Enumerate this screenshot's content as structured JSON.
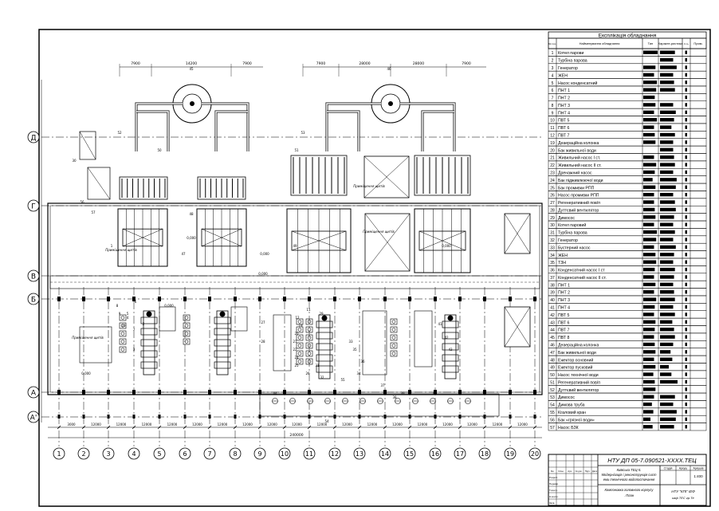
{
  "spec": {
    "title": "Експлікація обладнання",
    "col_headers": {
      "num": "№ поз.",
      "name": "Найменування обладнання",
      "type": "Тип",
      "char": "Характе-ристика",
      "qty": "К-ть",
      "note": "Прим."
    },
    "rows": [
      {
        "n": "1",
        "name": "Котел парови"
      },
      {
        "n": "2",
        "name": "Турбіна парова"
      },
      {
        "n": "3",
        "name": "Генератор"
      },
      {
        "n": "4",
        "name": "ЖЕН"
      },
      {
        "n": "5",
        "name": "Насос конденсатний"
      },
      {
        "n": "6",
        "name": "ПНТ 1"
      },
      {
        "n": "7",
        "name": "ПНТ 2"
      },
      {
        "n": "8",
        "name": "ПНТ 3"
      },
      {
        "n": "9",
        "name": "ПНТ 4"
      },
      {
        "n": "10",
        "name": "ПВТ 5"
      },
      {
        "n": "11",
        "name": "ПВТ 6"
      },
      {
        "n": "12",
        "name": "ПВТ 7"
      },
      {
        "n": "19",
        "name": "Деаераційна колонка"
      },
      {
        "n": "20",
        "name": "Бак живильної води"
      },
      {
        "n": "21",
        "name": "Живильний насос І ст."
      },
      {
        "n": "22",
        "name": "Живильний насос ІІ ст."
      },
      {
        "n": "23",
        "name": "Дренажний насос"
      },
      {
        "n": "24",
        "name": "Бак підживлюючої води"
      },
      {
        "n": "25",
        "name": "Бак промивки РПП"
      },
      {
        "n": "26",
        "name": "Насос промивки РПП"
      },
      {
        "n": "27",
        "name": "Регенеративний пов/п"
      },
      {
        "n": "28",
        "name": "Дуттєвий вентилятор"
      },
      {
        "n": "29",
        "name": "Димосос"
      },
      {
        "n": "30",
        "name": "Котел паровий"
      },
      {
        "n": "31",
        "name": "Турбіна парова"
      },
      {
        "n": "32",
        "name": "Генератор"
      },
      {
        "n": "33",
        "name": "Бустерний насос"
      },
      {
        "n": "34",
        "name": "ЖЕН"
      },
      {
        "n": "35",
        "name": "ТЗН"
      },
      {
        "n": "36",
        "name": "Конденсатний насос І ст"
      },
      {
        "n": "37",
        "name": "Конденсатний насос ІІ ст."
      },
      {
        "n": "38",
        "name": "ПНТ 1"
      },
      {
        "n": "39",
        "name": "ПНТ 2"
      },
      {
        "n": "40",
        "name": "ПНТ 3"
      },
      {
        "n": "41",
        "name": "ПНТ 4"
      },
      {
        "n": "42",
        "name": "ПВТ 5"
      },
      {
        "n": "43",
        "name": "ПВТ 6"
      },
      {
        "n": "44",
        "name": "ПВТ 7"
      },
      {
        "n": "45",
        "name": "ПВТ 8"
      },
      {
        "n": "46",
        "name": "Деаераційна колонка"
      },
      {
        "n": "47",
        "name": "Бак живильної води"
      },
      {
        "n": "48",
        "name": "Ежектор основний"
      },
      {
        "n": "49",
        "name": "Ежектор пусковий"
      },
      {
        "n": "50",
        "name": "Насос технічної води"
      },
      {
        "n": "51",
        "name": "Регенеративний пов/п"
      },
      {
        "n": "52",
        "name": "Дуттєвий вентилятор"
      },
      {
        "n": "53",
        "name": "Димосос"
      },
      {
        "n": "54",
        "name": "Димова труба"
      },
      {
        "n": "55",
        "name": "Козловий кран"
      },
      {
        "n": "56",
        "name": "Бак «грязної води»"
      },
      {
        "n": "57",
        "name": "Насос БЗК"
      }
    ]
  },
  "plan": {
    "axes_letters": [
      "Д",
      "Г",
      "В",
      "Б",
      "А",
      "А'"
    ],
    "axes_numbers": [
      "1",
      "2",
      "3",
      "4",
      "5",
      "6",
      "7",
      "8",
      "9",
      "10",
      "11",
      "12",
      "13",
      "14",
      "15",
      "16",
      "17",
      "18",
      "19",
      "20"
    ],
    "dims_top_left": [
      "7900",
      "14200",
      "7900"
    ],
    "dims_top_right": [
      "7900",
      "28000",
      "28000",
      "7900"
    ],
    "dims_bottom": [
      "3000",
      "12000",
      "12000",
      "12000",
      "12000",
      "12000",
      "12000",
      "12000",
      "12000",
      "12000",
      "12000",
      "12000",
      "12000",
      "12000",
      "12000",
      "12000",
      "12000",
      "12000",
      "12000"
    ],
    "dim_bottom_total": "240000",
    "room_labels": [
      "Приміщення щитів",
      "Приміщення щитів",
      "Приміщення щитів",
      "Приміщення щитів"
    ],
    "marks": [
      "0,000",
      "0,000",
      "0,000",
      "0,000",
      "0,000",
      "0,000"
    ],
    "callouts": [
      "56",
      "57",
      "30",
      "1",
      "2",
      "3",
      "4",
      "5",
      "6",
      "7",
      "8",
      "9",
      "10",
      "11",
      "12",
      "19",
      "20",
      "21",
      "22",
      "24",
      "25",
      "26",
      "27",
      "28",
      "29",
      "31",
      "32",
      "33",
      "34",
      "35",
      "36",
      "37",
      "38",
      "39",
      "40",
      "41",
      "42",
      "43",
      "44",
      "45",
      "46",
      "47",
      "48",
      "49",
      "50",
      "51",
      "52",
      "53",
      "54",
      "55"
    ]
  },
  "stamp": {
    "code": "НТУ ДП 05-7.090521-ХХХХ.ТЕЦ",
    "project_title": "Київська ТЕЦ-5. Модернізація і реконструкція системи технічного водопостачання",
    "sheet_title": "Компоновка головного корпусу. План",
    "stage_hdr": "Стадія",
    "sheet_hdr": "Аркуш",
    "sheets_hdr": "Аркушів",
    "scale": "1:400",
    "org": "НТУ \"КПІ\" ІЕФ каф ТЕС гр.Те",
    "roles": [
      "Зм.",
      "Кільк.",
      "Арк.",
      "№ док.",
      "Підп.",
      "Дата",
      "Розроб.",
      "Перевір.",
      "Т.контр.",
      "Н.контр.",
      "Затв."
    ]
  }
}
